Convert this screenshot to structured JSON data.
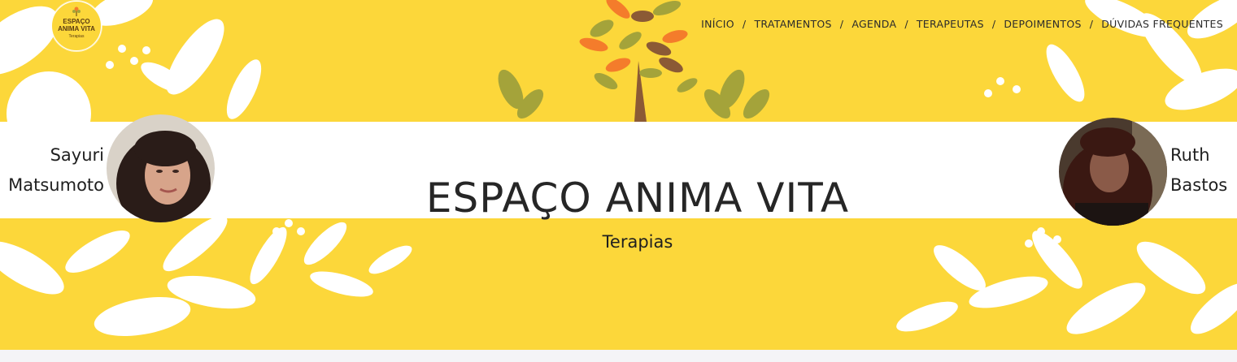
{
  "brand": {
    "logo_line1": "ESPAÇO",
    "logo_line2": "ANIMA VITA",
    "logo_tagline": "Terapias"
  },
  "nav": {
    "items": [
      {
        "label": "INÍCIO"
      },
      {
        "label": "TRATAMENTOS"
      },
      {
        "label": "AGENDA"
      },
      {
        "label": "TERAPEUTAS"
      },
      {
        "label": "DEPOIMENTOS"
      },
      {
        "label": "DÚVIDAS FREQUENTES"
      }
    ],
    "separator": "/"
  },
  "hero": {
    "title": "ESPAÇO ANIMA VITA",
    "subtitle": "Terapias"
  },
  "therapists": [
    {
      "first": "Sayuri",
      "last": "Matsumoto"
    },
    {
      "first": "Ruth",
      "last": "Bastos"
    }
  ],
  "colors": {
    "background": "#fcd73a",
    "band": "#ffffff",
    "text": "#262626",
    "leaf_orange": "#f47c2b",
    "leaf_olive": "#a4a33a",
    "leaf_brown": "#8b5a35"
  }
}
